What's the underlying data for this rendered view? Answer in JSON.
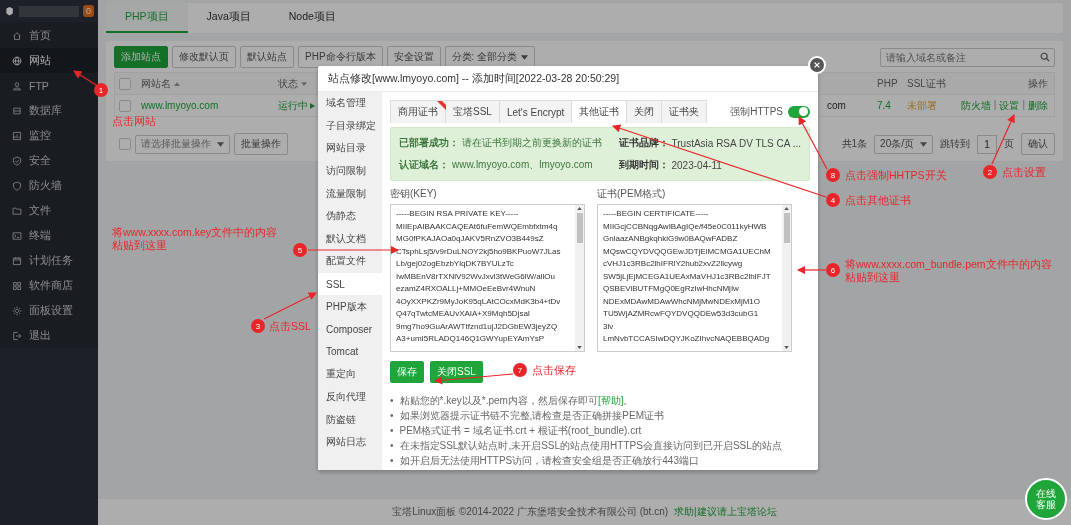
{
  "sidebar": {
    "badge": "0",
    "items": [
      {
        "label": "首页",
        "selected": false
      },
      {
        "label": "网站",
        "selected": true
      },
      {
        "label": "FTP",
        "selected": false
      },
      {
        "label": "数据库",
        "selected": false
      },
      {
        "label": "监控",
        "selected": false
      },
      {
        "label": "安全",
        "selected": false
      },
      {
        "label": "防火墙",
        "selected": false
      },
      {
        "label": "文件",
        "selected": false
      },
      {
        "label": "终端",
        "selected": false
      },
      {
        "label": "计划任务",
        "selected": false
      },
      {
        "label": "软件商店",
        "selected": false
      },
      {
        "label": "面板设置",
        "selected": false
      },
      {
        "label": "退出",
        "selected": false
      }
    ]
  },
  "project_tabs": [
    {
      "label": "PHP项目",
      "selected": true
    },
    {
      "label": "Java项目",
      "selected": false
    },
    {
      "label": "Node项目",
      "selected": false
    }
  ],
  "toolbar": {
    "buttons": [
      {
        "label": "添加站点",
        "kind": "primary"
      },
      {
        "label": "修改默认页",
        "kind": "plain"
      },
      {
        "label": "默认站点",
        "kind": "plain"
      },
      {
        "label": "PHP命令行版本",
        "kind": "plain"
      },
      {
        "label": "安全设置",
        "kind": "plain"
      }
    ],
    "category": "分类: 全部分类",
    "search": {
      "placeholder": "请输入域名或备注"
    }
  },
  "table": {
    "header_checked": false,
    "columns": [
      {
        "label": "网站名",
        "sort_ascending": true
      },
      {
        "label": "状态",
        "sort_ascending": false
      },
      {
        "label": "PHP"
      },
      {
        "label": "SSL证书"
      },
      {
        "label": "操作"
      }
    ],
    "rows": [
      {
        "checked": false,
        "name": "www.lmyoyo.com",
        "status": "运行中",
        "remark": "com",
        "php": "7.4",
        "ssl": "未部署",
        "actions": [
          "防火墙",
          "设置",
          "删除"
        ],
        "separators": [
          "|",
          "|"
        ]
      }
    ]
  },
  "batch": {
    "checked": false,
    "select": "请选择批量操作",
    "button": "批量操作"
  },
  "pagination": {
    "total": "共1条",
    "per_page": "20条/页",
    "goto": "跳转到",
    "page": "1",
    "unit": "页",
    "confirm": "确认"
  },
  "modal": {
    "title": "站点修改[www.lmyoyo.com] -- 添加时间[2022-03-28 20:50:29]",
    "menu": [
      {
        "label": "域名管理",
        "selected": false
      },
      {
        "label": "子目录绑定",
        "selected": false
      },
      {
        "label": "网站目录",
        "selected": false
      },
      {
        "label": "访问限制",
        "selected": false
      },
      {
        "label": "流量限制",
        "selected": false
      },
      {
        "label": "伪静态",
        "selected": false
      },
      {
        "label": "默认文档",
        "selected": false
      },
      {
        "label": "配置文件",
        "selected": false
      },
      {
        "label": "SSL",
        "selected": true
      },
      {
        "label": "PHP版本",
        "selected": false
      },
      {
        "label": "Composer",
        "selected": false
      },
      {
        "label": "Tomcat",
        "selected": false
      },
      {
        "label": "重定向",
        "selected": false
      },
      {
        "label": "反向代理",
        "selected": false
      },
      {
        "label": "防盗链",
        "selected": false
      },
      {
        "label": "网站日志",
        "selected": false
      }
    ],
    "tabs": [
      {
        "label": "商用证书",
        "selected": false,
        "ribbon": true
      },
      {
        "label": "宝塔SSL",
        "selected": false,
        "ribbon": false
      },
      {
        "label": "Let's Encrypt",
        "selected": false,
        "ribbon": false
      },
      {
        "label": "其他证书",
        "selected": true,
        "ribbon": false
      },
      {
        "label": "关闭",
        "selected": false,
        "ribbon": false
      },
      {
        "label": "证书夹",
        "selected": false,
        "ribbon": false
      }
    ],
    "force_https": {
      "label": "强制HTTPS",
      "on": true
    },
    "info": [
      {
        "label": "已部署成功：",
        "value": "请在证书到期之前更换新的证书"
      },
      {
        "label": "证书品牌：",
        "value": "TrustAsia RSA DV TLS CA ..."
      },
      {
        "label": "认证域名：",
        "value": "www.lmyoyo.com、lmyoyo.com"
      },
      {
        "label": "到期时间：",
        "value": "2023-04-11"
      }
    ],
    "key": {
      "label": "密钥(KEY)",
      "lines": [
        "-----BEGIN RSA PRIVATE KEY-----",
        "MIIEpAIBAAKCAQEAt6fuFemWQEmbfxtm4q",
        "MG0fPKAJAOa0qJAKV5RnZVO3B449sZ",
        "CTsphLsj5/v9rDuLNOY2kj5ho9BKPuoW7JLas",
        "Lb/gej02ogEbzbYlqDK7BYULzTc",
        "IwMBEnV8rTXNlV92WvJxvl3tWeG6lW/allOu",
        "ezamZ4RXOALLj+MMOeEeBvr4WnuN",
        "4OyXXPKZr9MyJoK95qLAtCOcxMdK3b4+tDv",
        "Q47qTwtcMEAUvXAIA+X9Mqh5DjsaI",
        "9mg7ho9GuArAWTtfznd1ujJ2DGbEW3jeyZQ",
        "A3+umI5RLADQ146Q1GWYupEYAmYsP"
      ]
    },
    "cert": {
      "label": "证书(PEM格式)",
      "lines": [
        "-----BEGIN CERTIFICATE-----",
        "MIIGcjCCBNqgAwIBAgIQe/f45e0C011kyHWB",
        "GnlaazANBgkqhkiG9w0BAQwFADBZ",
        "MQswCQYDVQQGEwJDTjElMCMGA1UEChM",
        "cVHJ1c3RBc2lhIFRlY2hub2xvZ2llcywg",
        "SW5jLjEjMCEGA1UEAxMaVHJ1c3RBc2lhIFJT",
        "QSBEViBUTFMgQ0EgRzIwHhcNMjIw",
        "NDExMDAwMDAwWhcNMjMwNDExMjM1O",
        "TU5WjAZMRcwFQYDVQQDEw53d3cubG1",
        "3lv",
        "LmNvbTCCASIwDQYJKoZIhvcNAQEBBQADg"
      ]
    },
    "buttons": [
      "保存",
      "关闭SSL"
    ],
    "notes": [
      {
        "bullet": "•",
        "text": "粘贴您的*.key以及*.pem内容，然后保存即可",
        "link": "[帮助]",
        "end": "。"
      },
      {
        "bullet": "•",
        "text": "如果浏览器提示证书链不完整,请检查是否正确拼接PEM证书"
      },
      {
        "bullet": "•",
        "text": "PEM格式证书 = 域名证书.crt + 根证书(root_bundle).crt"
      },
      {
        "bullet": "•",
        "text": "在未指定SSL默认站点时,未开启SSL的站点使用HTTPS会直接访问到已开启SSL的站点"
      },
      {
        "bullet": "•",
        "text": "如开启后无法使用HTTPS访问，请检查安全组是否正确放行443端口"
      }
    ]
  },
  "annotations": [
    {
      "number": "1",
      "text": "点击网站"
    },
    {
      "number": "2",
      "text": "点击设置"
    },
    {
      "number": "3",
      "text": "点击SSL"
    },
    {
      "number": "4",
      "text": "点击其他证书"
    },
    {
      "number": "5",
      "text": "将www.xxxx.com.key文件中的内容粘贴到这里"
    },
    {
      "number": "6",
      "text": "将www.xxxx.com_bundle.pem文件中的内容粘贴到这里"
    },
    {
      "number": "7",
      "text": "点击保存"
    },
    {
      "number": "8",
      "text": "点击强制HHTPS开关"
    }
  ],
  "footer": {
    "text": "宝塔Linux面板 ©2014-2022 广东堡塔安全技术有限公司 (bt.cn)",
    "link": "求助|建议请上宝塔论坛"
  },
  "chat_button": "在线客服"
}
